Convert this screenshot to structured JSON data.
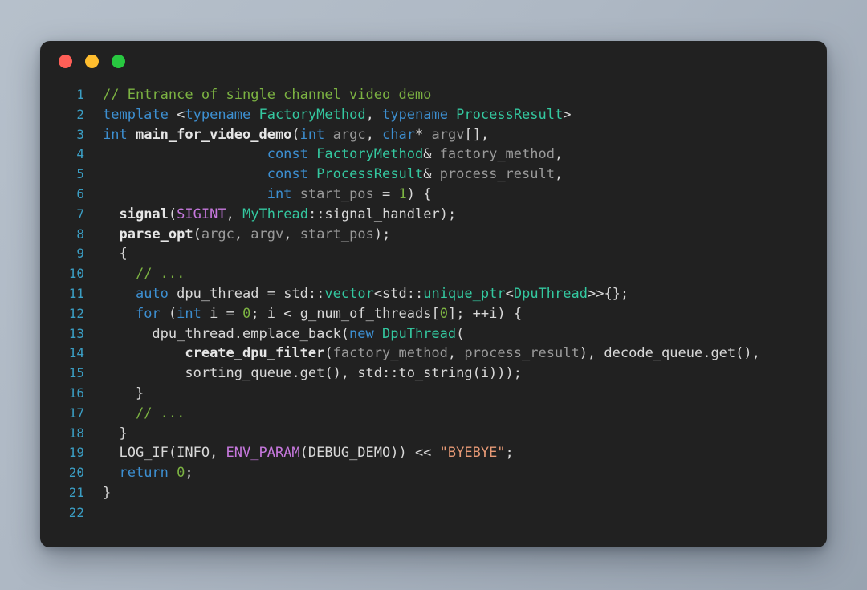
{
  "window": {
    "background_color": "#212121",
    "desktop_color": "#aeb8c4",
    "traffic_lights": [
      {
        "name": "close",
        "color": "#ff5f57"
      },
      {
        "name": "minimize",
        "color": "#ffbd2e"
      },
      {
        "name": "maximize",
        "color": "#28c840"
      }
    ]
  },
  "editor": {
    "language": "cpp",
    "theme": "dark",
    "font_size": 17,
    "line_numbers": [
      "1",
      "2",
      "3",
      "4",
      "5",
      "6",
      "7",
      "8",
      "9",
      "10",
      "11",
      "12",
      "13",
      "14",
      "15",
      "16",
      "17",
      "18",
      "19",
      "20",
      "21",
      "22"
    ],
    "lines": [
      {
        "n": "1",
        "tokens": [
          {
            "t": "// Entrance of single channel video demo",
            "c": "cmt"
          }
        ]
      },
      {
        "n": "2",
        "tokens": [
          {
            "t": "template ",
            "c": "kw"
          },
          {
            "t": "<",
            "c": "pln"
          },
          {
            "t": "typename ",
            "c": "kw"
          },
          {
            "t": "FactoryMethod",
            "c": "type"
          },
          {
            "t": ", ",
            "c": "pln"
          },
          {
            "t": "typename ",
            "c": "kw"
          },
          {
            "t": "ProcessResult",
            "c": "type"
          },
          {
            "t": ">",
            "c": "pln"
          }
        ]
      },
      {
        "n": "3",
        "tokens": [
          {
            "t": "int ",
            "c": "kw"
          },
          {
            "t": "main_for_video_demo",
            "c": "fn"
          },
          {
            "t": "(",
            "c": "pln"
          },
          {
            "t": "int ",
            "c": "kw"
          },
          {
            "t": "argc",
            "c": "var"
          },
          {
            "t": ", ",
            "c": "pln"
          },
          {
            "t": "char",
            "c": "kw"
          },
          {
            "t": "* ",
            "c": "pln"
          },
          {
            "t": "argv",
            "c": "var"
          },
          {
            "t": "[],",
            "c": "pln"
          }
        ]
      },
      {
        "n": "4",
        "tokens": [
          {
            "t": "                    ",
            "c": "pln"
          },
          {
            "t": "const ",
            "c": "kw"
          },
          {
            "t": "FactoryMethod",
            "c": "type"
          },
          {
            "t": "& ",
            "c": "pln"
          },
          {
            "t": "factory_method",
            "c": "var"
          },
          {
            "t": ",",
            "c": "pln"
          }
        ]
      },
      {
        "n": "5",
        "tokens": [
          {
            "t": "                    ",
            "c": "pln"
          },
          {
            "t": "const ",
            "c": "kw"
          },
          {
            "t": "ProcessResult",
            "c": "type"
          },
          {
            "t": "& ",
            "c": "pln"
          },
          {
            "t": "process_result",
            "c": "var"
          },
          {
            "t": ",",
            "c": "pln"
          }
        ]
      },
      {
        "n": "6",
        "tokens": [
          {
            "t": "                    ",
            "c": "pln"
          },
          {
            "t": "int ",
            "c": "kw"
          },
          {
            "t": "start_pos",
            "c": "var"
          },
          {
            "t": " = ",
            "c": "pln"
          },
          {
            "t": "1",
            "c": "num"
          },
          {
            "t": ") {",
            "c": "pln"
          }
        ]
      },
      {
        "n": "7",
        "tokens": [
          {
            "t": "  ",
            "c": "pln"
          },
          {
            "t": "signal",
            "c": "fn"
          },
          {
            "t": "(",
            "c": "pln"
          },
          {
            "t": "SIGINT",
            "c": "mac"
          },
          {
            "t": ", ",
            "c": "pln"
          },
          {
            "t": "MyThread",
            "c": "type"
          },
          {
            "t": "::signal_handler);",
            "c": "pln"
          }
        ]
      },
      {
        "n": "8",
        "tokens": [
          {
            "t": "  ",
            "c": "pln"
          },
          {
            "t": "parse_opt",
            "c": "fn"
          },
          {
            "t": "(",
            "c": "pln"
          },
          {
            "t": "argc",
            "c": "var"
          },
          {
            "t": ", ",
            "c": "pln"
          },
          {
            "t": "argv",
            "c": "var"
          },
          {
            "t": ", ",
            "c": "pln"
          },
          {
            "t": "start_pos",
            "c": "var"
          },
          {
            "t": ");",
            "c": "pln"
          }
        ]
      },
      {
        "n": "9",
        "tokens": [
          {
            "t": "  {",
            "c": "pln"
          }
        ]
      },
      {
        "n": "10",
        "tokens": [
          {
            "t": "    ",
            "c": "pln"
          },
          {
            "t": "// ...",
            "c": "cmt"
          }
        ]
      },
      {
        "n": "11",
        "tokens": [
          {
            "t": "    ",
            "c": "pln"
          },
          {
            "t": "auto ",
            "c": "kw"
          },
          {
            "t": "dpu_thread",
            "c": "pln"
          },
          {
            "t": " = std::",
            "c": "pln"
          },
          {
            "t": "vector",
            "c": "type"
          },
          {
            "t": "<std::",
            "c": "pln"
          },
          {
            "t": "unique_ptr",
            "c": "type"
          },
          {
            "t": "<",
            "c": "pln"
          },
          {
            "t": "DpuThread",
            "c": "type"
          },
          {
            "t": ">>{};",
            "c": "pln"
          }
        ]
      },
      {
        "n": "12",
        "tokens": [
          {
            "t": "    ",
            "c": "pln"
          },
          {
            "t": "for ",
            "c": "kw"
          },
          {
            "t": "(",
            "c": "pln"
          },
          {
            "t": "int ",
            "c": "kw"
          },
          {
            "t": "i = ",
            "c": "pln"
          },
          {
            "t": "0",
            "c": "num"
          },
          {
            "t": "; i < g_num_of_threads[",
            "c": "pln"
          },
          {
            "t": "0",
            "c": "num"
          },
          {
            "t": "]; ++i) {",
            "c": "pln"
          }
        ]
      },
      {
        "n": "13",
        "tokens": [
          {
            "t": "      dpu_thread.emplace_back(",
            "c": "pln"
          },
          {
            "t": "new ",
            "c": "kw"
          },
          {
            "t": "DpuThread",
            "c": "type"
          },
          {
            "t": "(",
            "c": "pln"
          }
        ]
      },
      {
        "n": "14",
        "tokens": [
          {
            "t": "          ",
            "c": "pln"
          },
          {
            "t": "create_dpu_filter",
            "c": "fn"
          },
          {
            "t": "(",
            "c": "pln"
          },
          {
            "t": "factory_method",
            "c": "var"
          },
          {
            "t": ", ",
            "c": "pln"
          },
          {
            "t": "process_result",
            "c": "var"
          },
          {
            "t": "), decode_queue.get(),",
            "c": "pln"
          }
        ]
      },
      {
        "n": "15",
        "tokens": [
          {
            "t": "          sorting_queue.get(), std::to_string(i)));",
            "c": "pln"
          }
        ]
      },
      {
        "n": "16",
        "tokens": [
          {
            "t": "    }",
            "c": "pln"
          }
        ]
      },
      {
        "n": "17",
        "tokens": [
          {
            "t": "    ",
            "c": "pln"
          },
          {
            "t": "// ...",
            "c": "cmt"
          }
        ]
      },
      {
        "n": "18",
        "tokens": [
          {
            "t": "  }",
            "c": "pln"
          }
        ]
      },
      {
        "n": "19",
        "tokens": [
          {
            "t": "  LOG_IF(INFO, ",
            "c": "pln"
          },
          {
            "t": "ENV_PARAM",
            "c": "mac"
          },
          {
            "t": "(DEBUG_DEMO)) << ",
            "c": "pln"
          },
          {
            "t": "\"BYEBYE\"",
            "c": "str"
          },
          {
            "t": ";",
            "c": "pln"
          }
        ]
      },
      {
        "n": "20",
        "tokens": [
          {
            "t": "  ",
            "c": "pln"
          },
          {
            "t": "return ",
            "c": "kw"
          },
          {
            "t": "0",
            "c": "num"
          },
          {
            "t": ";",
            "c": "pln"
          }
        ]
      },
      {
        "n": "21",
        "tokens": [
          {
            "t": "}",
            "c": "pln"
          }
        ]
      },
      {
        "n": "22",
        "tokens": [
          {
            "t": "",
            "c": "pln"
          }
        ]
      }
    ]
  }
}
